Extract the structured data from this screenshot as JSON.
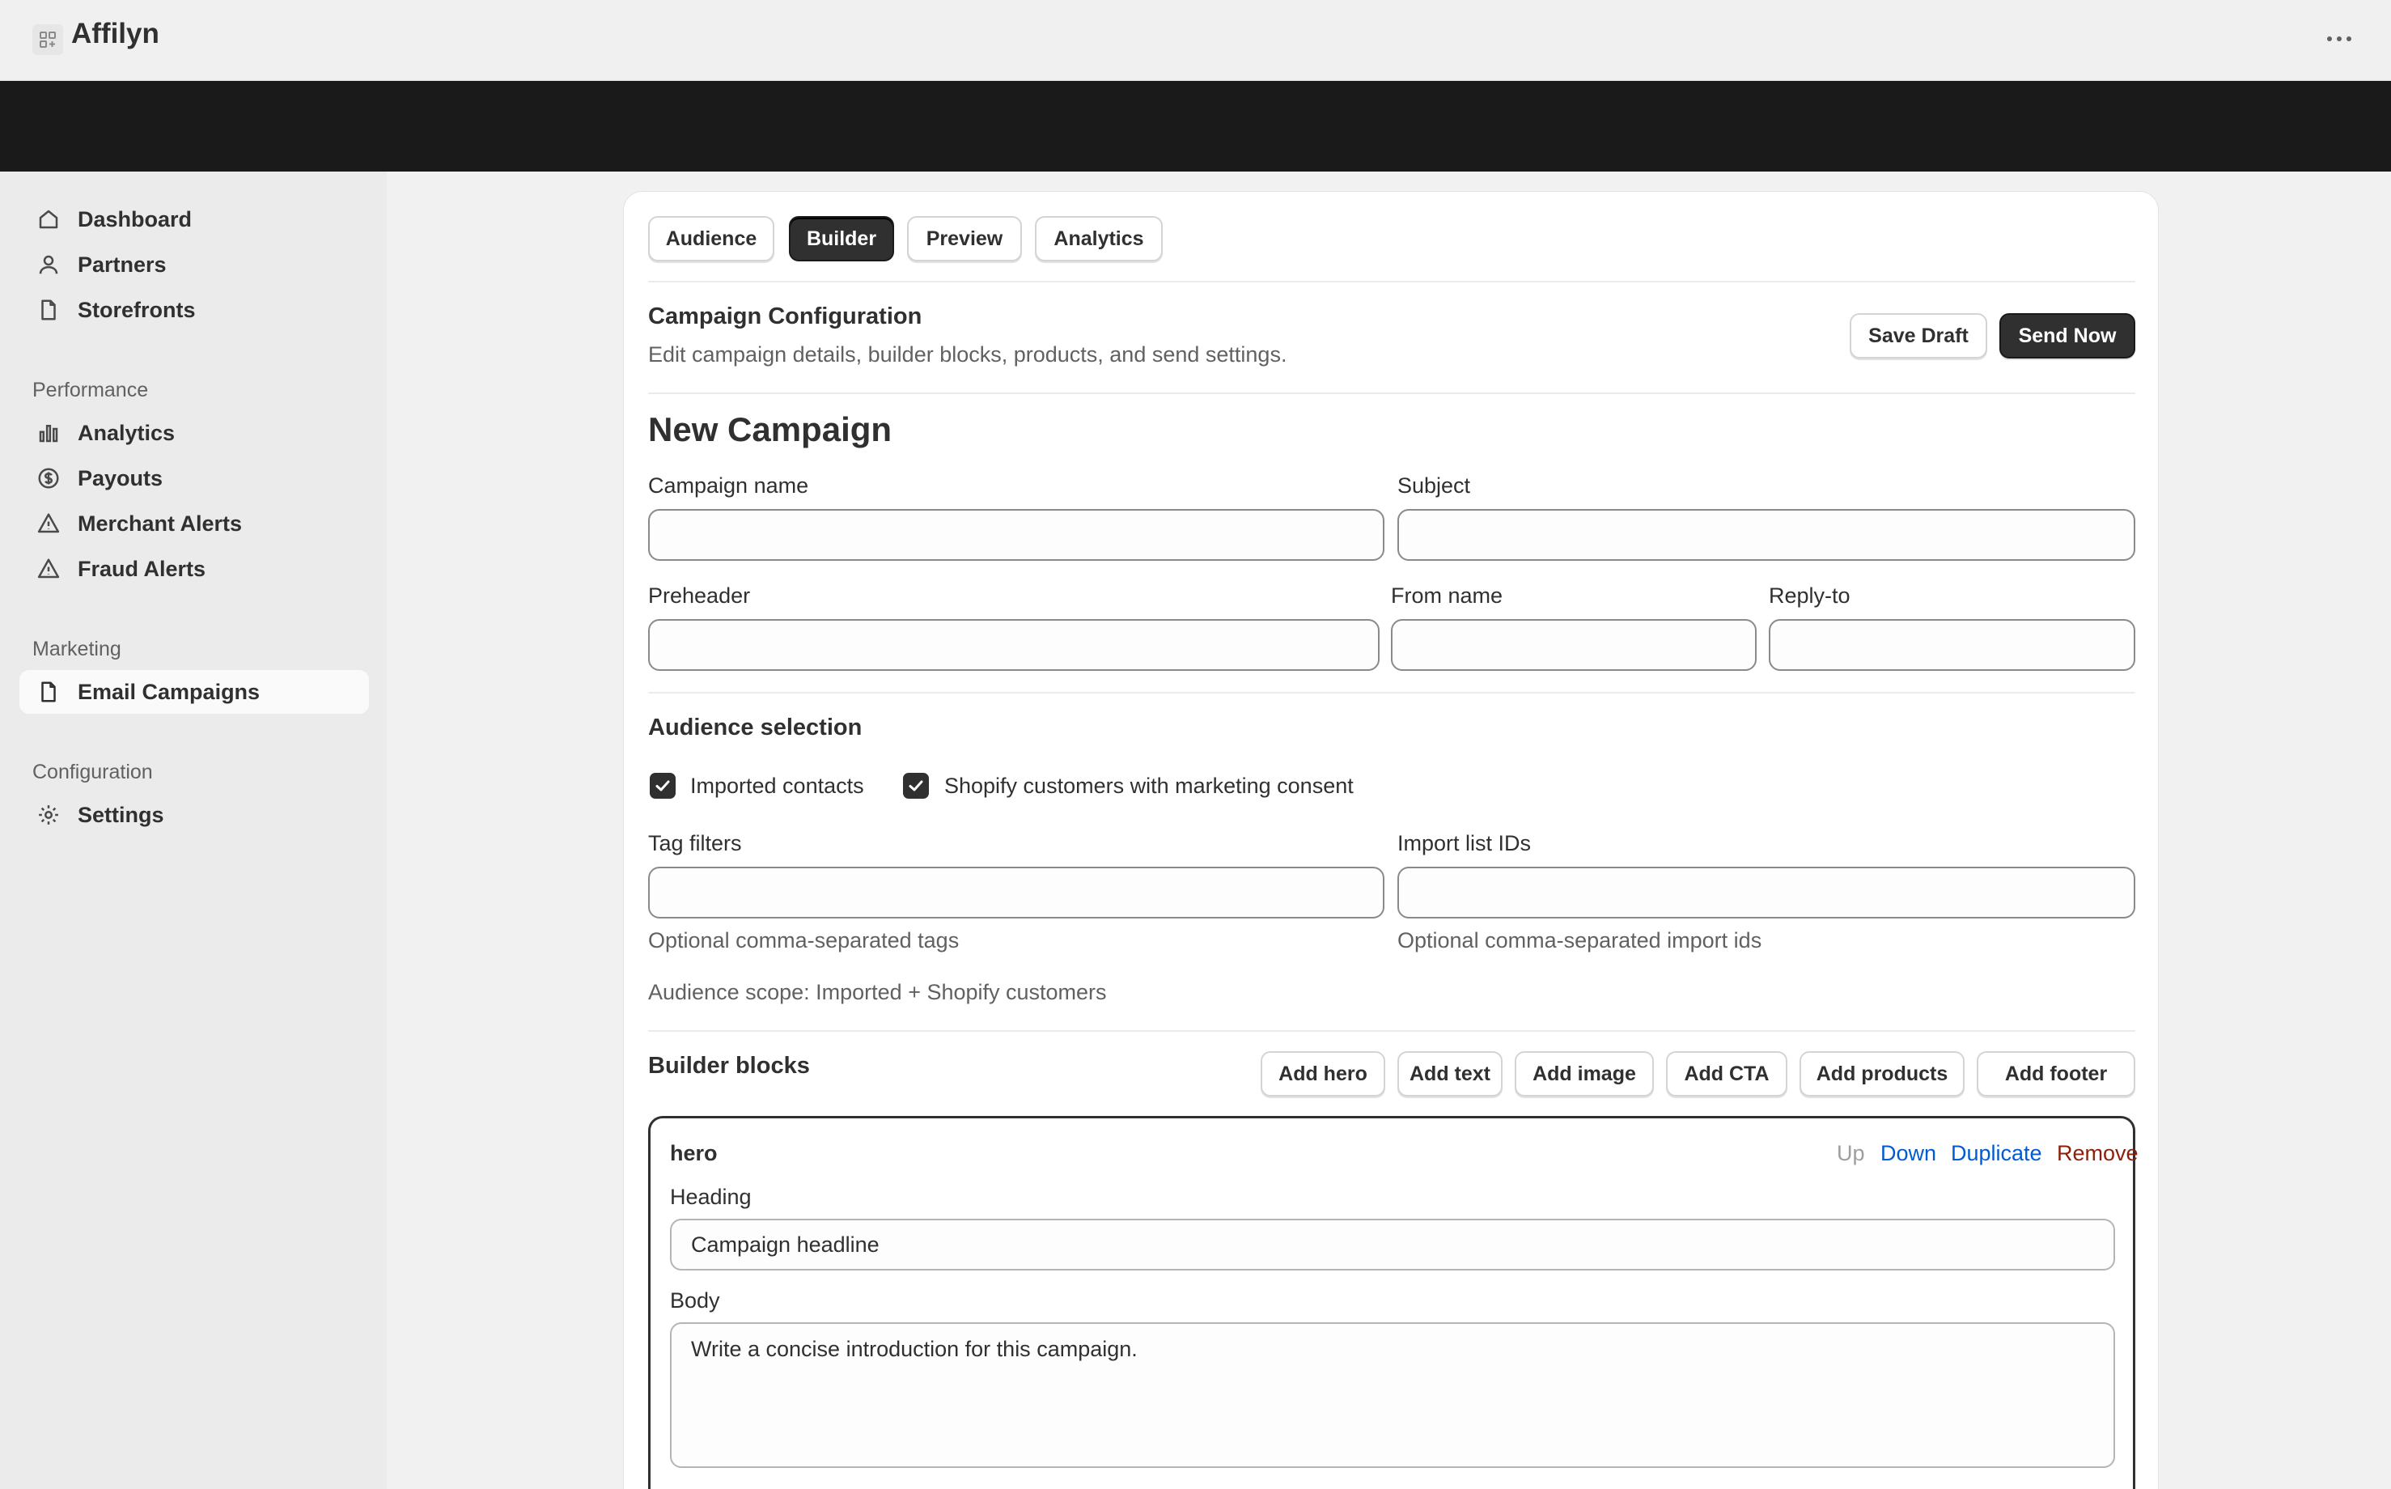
{
  "app": {
    "title": "Affilyn"
  },
  "sidebar": {
    "items_top": [
      {
        "label": "Dashboard",
        "icon": "home-icon"
      },
      {
        "label": "Partners",
        "icon": "person-icon"
      },
      {
        "label": "Storefronts",
        "icon": "page-icon"
      }
    ],
    "performance_title": "Performance",
    "performance_items": [
      {
        "label": "Analytics",
        "icon": "bar-chart-icon"
      },
      {
        "label": "Payouts",
        "icon": "dollar-circle-icon"
      },
      {
        "label": "Merchant Alerts",
        "icon": "alert-triangle-icon"
      },
      {
        "label": "Fraud Alerts",
        "icon": "alert-triangle-icon"
      }
    ],
    "marketing_title": "Marketing",
    "marketing_items": [
      {
        "label": "Email Campaigns",
        "icon": "page-icon",
        "active": true
      }
    ],
    "configuration_title": "Configuration",
    "configuration_items": [
      {
        "label": "Settings",
        "icon": "gear-icon"
      }
    ]
  },
  "tabs": [
    {
      "label": "Audience"
    },
    {
      "label": "Builder",
      "active": true
    },
    {
      "label": "Preview"
    },
    {
      "label": "Analytics"
    }
  ],
  "config": {
    "title": "Campaign Configuration",
    "subtitle": "Edit campaign details, builder blocks, products, and send settings.",
    "save_draft": "Save Draft",
    "send_now": "Send Now"
  },
  "form": {
    "heading": "New Campaign",
    "campaign_name_label": "Campaign name",
    "campaign_name_value": "",
    "subject_label": "Subject",
    "subject_value": "",
    "preheader_label": "Preheader",
    "preheader_value": "",
    "from_name_label": "From name",
    "from_name_value": "",
    "reply_to_label": "Reply-to",
    "reply_to_value": ""
  },
  "audience": {
    "title": "Audience selection",
    "imported_contacts": {
      "label": "Imported contacts",
      "checked": true
    },
    "shopify_customers": {
      "label": "Shopify customers with marketing consent",
      "checked": true
    },
    "tag_filters_label": "Tag filters",
    "tag_filters_value": "",
    "tag_filters_help": "Optional comma-separated tags",
    "import_ids_label": "Import list IDs",
    "import_ids_value": "",
    "import_ids_help": "Optional comma-separated import ids",
    "scope": "Audience scope: Imported + Shopify customers"
  },
  "builder": {
    "title": "Builder blocks",
    "add_buttons": [
      "Add hero",
      "Add text",
      "Add image",
      "Add CTA",
      "Add products",
      "Add footer"
    ],
    "block": {
      "type": "hero",
      "actions": {
        "up": "Up",
        "down": "Down",
        "duplicate": "Duplicate",
        "remove": "Remove"
      },
      "heading_label": "Heading",
      "heading_value": "Campaign headline",
      "body_label": "Body",
      "body_value": "Write a concise introduction for this campaign."
    }
  },
  "colors": {
    "primary_button": "#303030",
    "link_blue": "#005bd3",
    "remove_red": "#8e1f0b",
    "disabled_gray": "#9e9e9e",
    "dark_band": "#1a1a1a"
  }
}
